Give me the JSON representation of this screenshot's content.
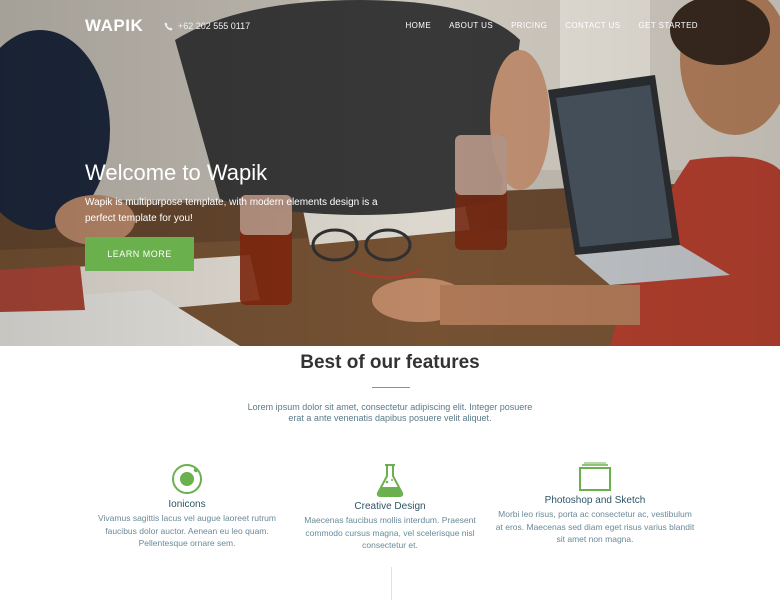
{
  "brand": {
    "logo": "WAPIK",
    "accent_color": "#6ab04c"
  },
  "nav": {
    "phone": "+62 202 555 0117",
    "phone_icon": "phone-icon",
    "items": [
      "HOME",
      "ABOUT US",
      "PRICING",
      "CONTACT US",
      "GET STARTED"
    ]
  },
  "hero": {
    "title": "Welcome to Wapik",
    "subtitle": "Wapik is multipurpose template, with modern elements design is a perfect template for you!",
    "button_label": "LEARN MORE"
  },
  "features": {
    "title": "Best of our features",
    "subtitle": "Lorem ipsum dolor sit amet, consectetur adipiscing elit. Integer posuere erat a ante venenatis dapibus posuere velit aliquet.",
    "items": [
      {
        "icon": "ionicons-icon",
        "name": "Ionicons",
        "desc": "Vivamus sagittis lacus vel augue laoreet rutrum faucibus dolor auctor. Aenean eu leo quam. Pellentesque ornare sem."
      },
      {
        "icon": "flask-icon",
        "name": "Creative Design",
        "desc": "Maecenas faucibus mollis interdum. Praesent commodo cursus magna, vel scelerisque nisl consectetur et."
      },
      {
        "icon": "layers-icon",
        "name": "Photoshop and Sketch",
        "desc": "Morbi leo risus, porta ac consectetur ac, vestibulum at eros. Maecenas sed diam eget risus varius blandit sit amet non magna."
      }
    ]
  }
}
